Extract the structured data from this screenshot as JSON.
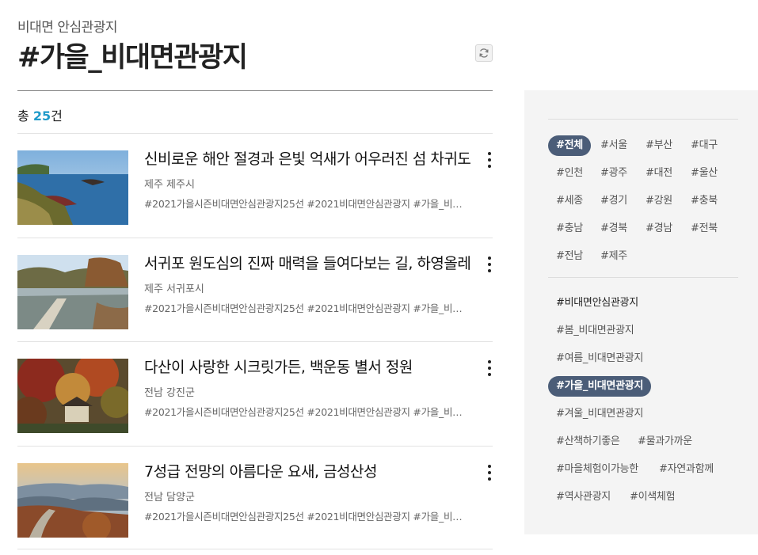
{
  "header": {
    "subtitle": "비대면 안심관광지",
    "title": "#가을_비대면관광지"
  },
  "count": {
    "prefix": "총",
    "number": "25",
    "suffix": "건"
  },
  "items": [
    {
      "title": "신비로운 해안 절경과 은빛 억새가 어우러진 섬 차귀도",
      "location": "제주 제주시",
      "tags": "#2021가을시즌비대면안심관광지25선 #2021비대면안심관광지 #가을_비대면관광지"
    },
    {
      "title": "서귀포 원도심의 진짜 매력을 들여다보는 길, 하영올레",
      "location": "제주 서귀포시",
      "tags": "#2021가을시즌비대면안심관광지25선 #2021비대면안심관광지 #가을_비대면관광지"
    },
    {
      "title": "다산이 사랑한 시크릿가든, 백운동 별서 정원",
      "location": "전남 강진군",
      "tags": "#2021가을시즌비대면안심관광지25선 #2021비대면안심관광지 #가을_비대면관광지"
    },
    {
      "title": "7성급 전망의 아름다운 요새, 금성산성",
      "location": "전남 담양군",
      "tags": "#2021가을시즌비대면안심관광지25선 #2021비대면안심관광지 #가을_비대면관광지"
    }
  ],
  "regions": [
    "#전체",
    "#서울",
    "#부산",
    "#대구",
    "#인천",
    "#광주",
    "#대전",
    "#울산",
    "#세종",
    "#경기",
    "#강원",
    "#충북",
    "#충남",
    "#경북",
    "#경남",
    "#전북",
    "#전남",
    "#제주"
  ],
  "themes": [
    "#비대면안심관광지",
    "#봄_비대면관광지",
    "#여름_비대면관광지",
    "#가을_비대면관광지",
    "#겨울_비대면관광지",
    "#산책하기좋은",
    "#물과가까운",
    "#마을체험이가능한",
    "#자연과함께",
    "#역사관광지",
    "#이색체험"
  ],
  "colors": {
    "accent": "#1f9ac9",
    "chip_active_bg": "#4b5d78",
    "sidebar_bg": "#f4f4f4"
  },
  "icons": {
    "refresh": "refresh-icon",
    "more": "more-vertical-icon"
  }
}
